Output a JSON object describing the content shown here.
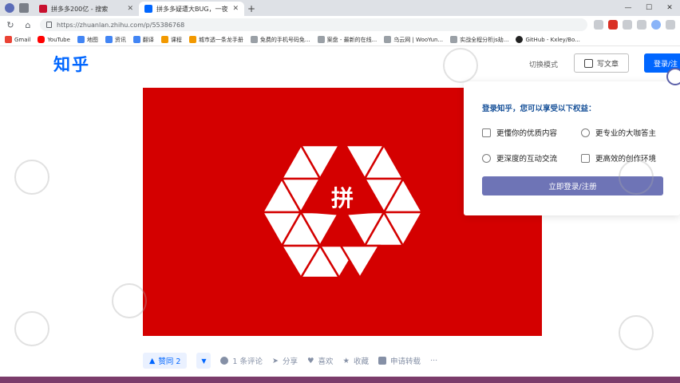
{
  "browser": {
    "tabs": [
      {
        "title": "拼多多200亿 - 搜索",
        "active": false
      },
      {
        "title": "拼多多疑遭大BUG，一夜被薅走...",
        "active": true
      }
    ],
    "new_tab_label": "+",
    "url": "https://zhuanlan.zhihu.com/p/55386768",
    "bookmarks": [
      "Gmail",
      "YouTube",
      "地图",
      "资讯",
      "翻译",
      "课程",
      "城市透一条龙手册",
      "免费的手机号码免...",
      "案盘 - 最新的在线...",
      "乌云网 | WooYun...",
      "实战全程分析js劫...",
      "GitHub - Kxley/Bo..."
    ]
  },
  "header": {
    "logo": "知乎",
    "switch_mode": "切换模式",
    "write_article": "写文章",
    "login": "登录/注"
  },
  "popup": {
    "title": "登录知乎，您可以享受以下权益：",
    "benefits": [
      "更懂你的优质内容",
      "更专业的大咖答主",
      "更深度的互动交流",
      "更高效的创作环境"
    ],
    "login_button": "立即登录/注册"
  },
  "hero": {
    "logo_char": "拼"
  },
  "actions": {
    "upvote": "赞同 2",
    "comments": "1 条评论",
    "share": "分享",
    "like": "喜欢",
    "collect": "收藏",
    "repost": "申请转载",
    "more": "···"
  },
  "colors": {
    "zhihu_blue": "#0066ff",
    "hero_red": "#d40000",
    "popup_button": "#6e74b6"
  }
}
